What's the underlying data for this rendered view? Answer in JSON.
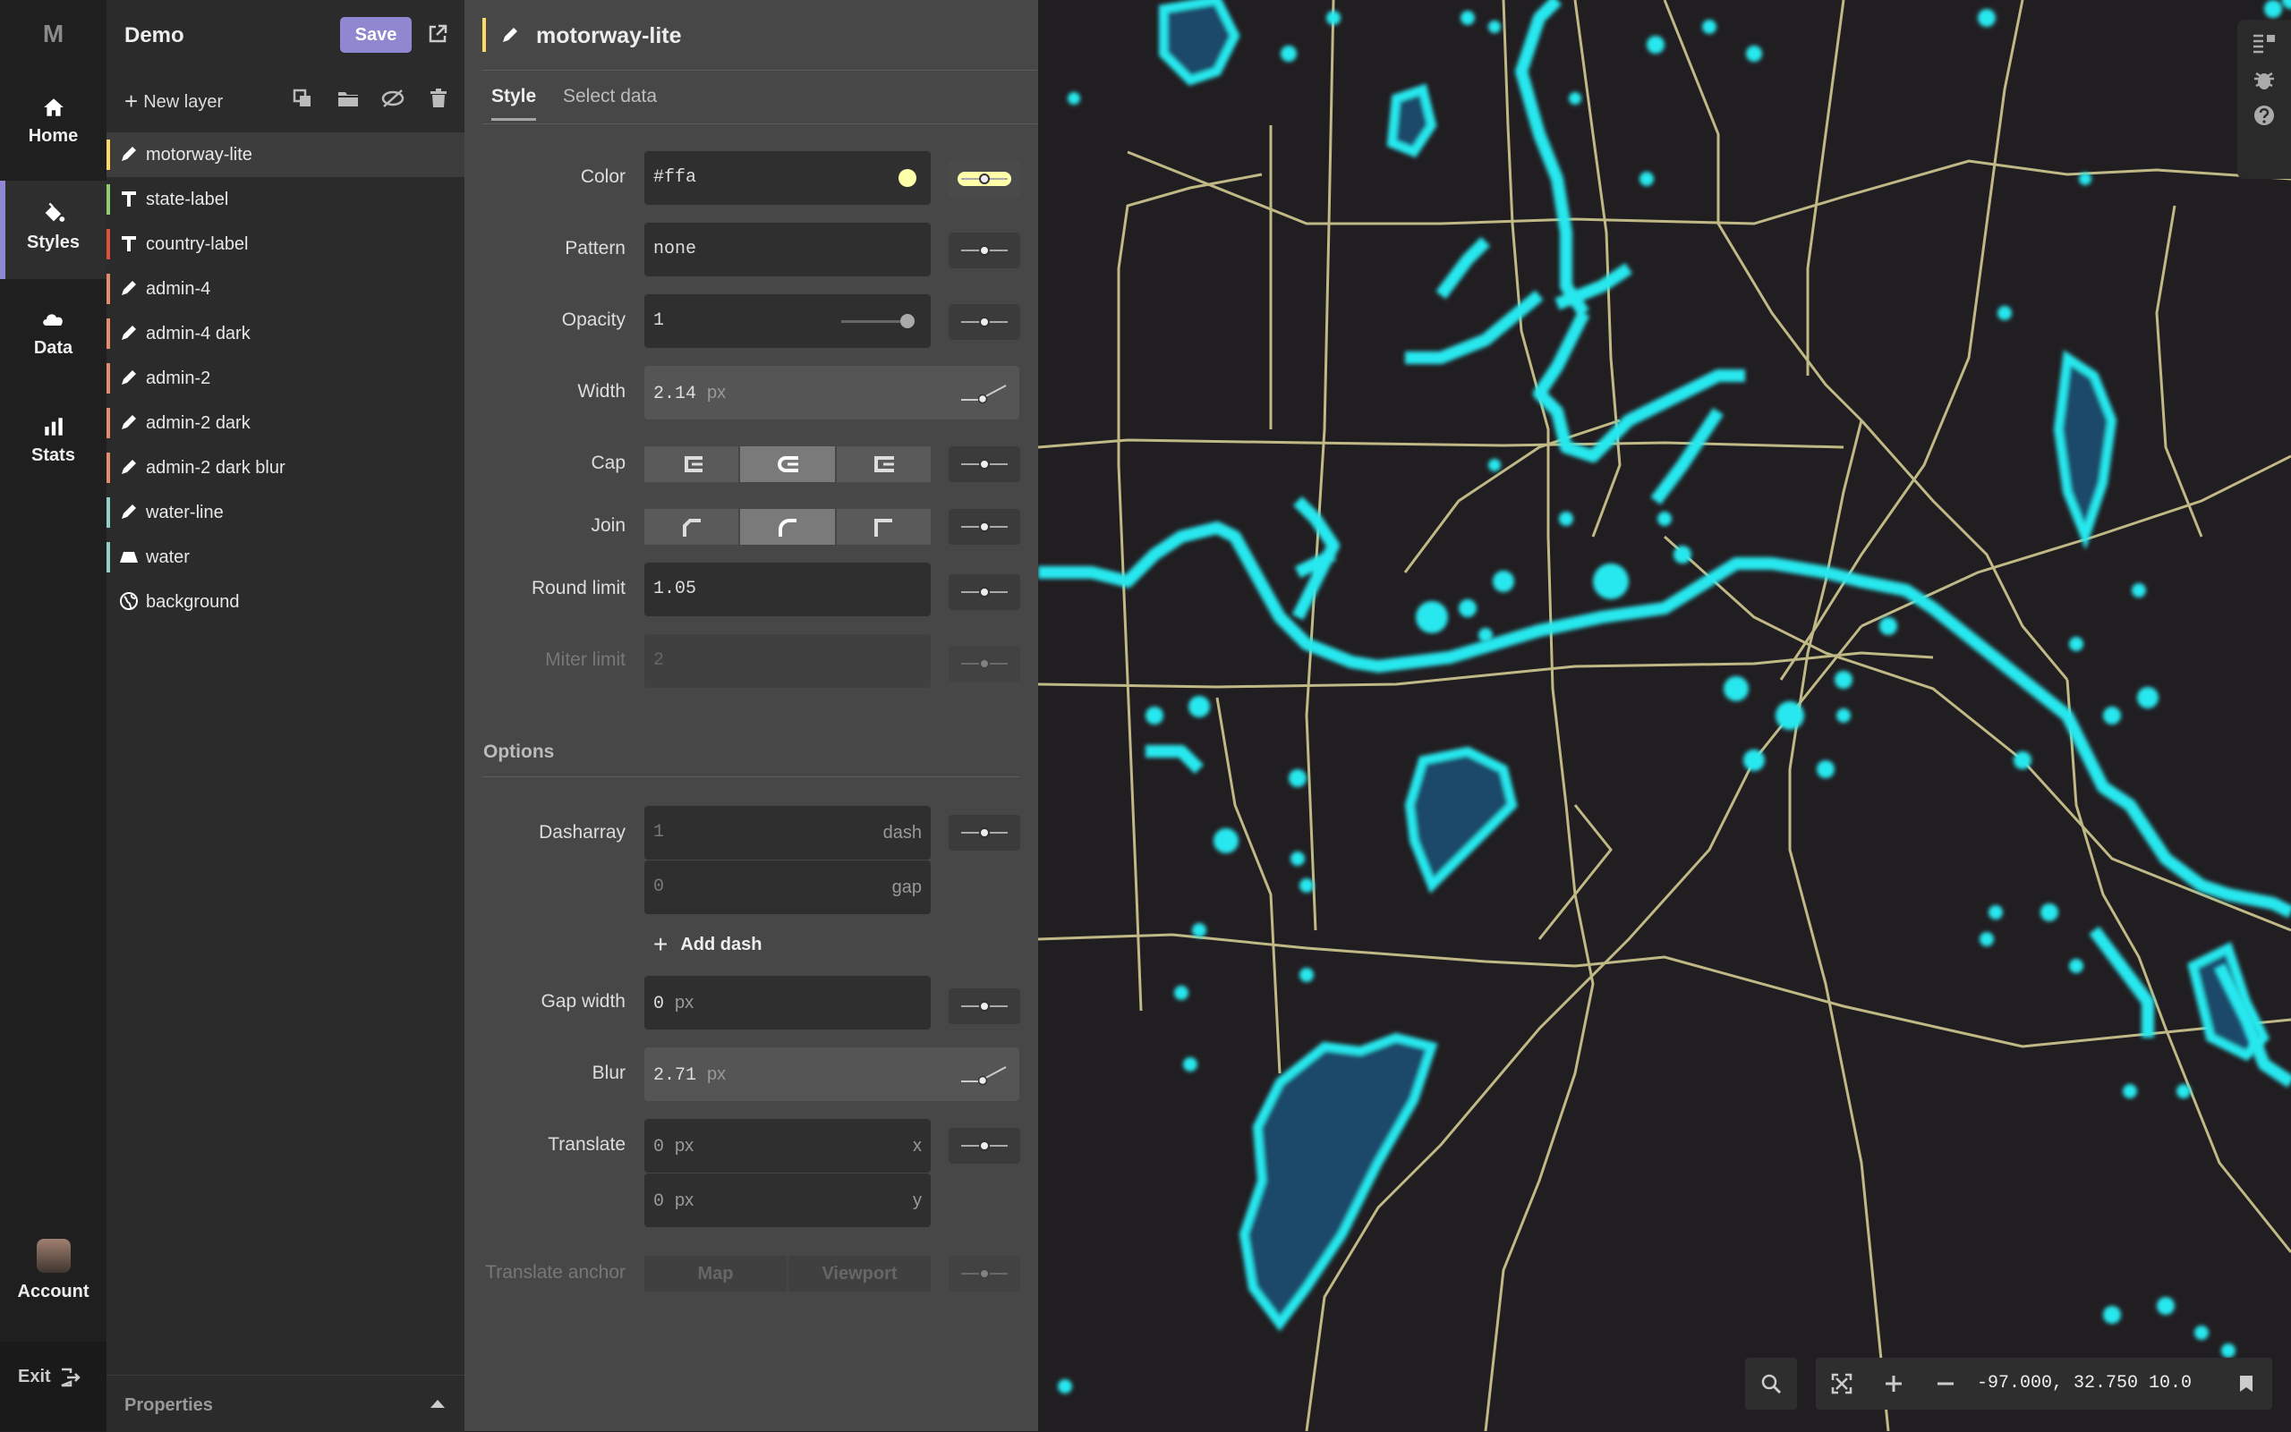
{
  "nav": {
    "logo": "M",
    "items": [
      {
        "label": "Home",
        "icon": "home-icon"
      },
      {
        "label": "Styles",
        "icon": "paint-bucket-icon"
      },
      {
        "label": "Data",
        "icon": "cloud-icon"
      },
      {
        "label": "Stats",
        "icon": "bar-chart-icon"
      }
    ],
    "account": "Account",
    "exit": "Exit"
  },
  "project": {
    "title": "Demo",
    "save": "Save",
    "new_layer": "New layer",
    "properties": "Properties"
  },
  "layers": [
    {
      "name": "motorway-lite",
      "color": "#ffd966",
      "type": "line"
    },
    {
      "name": "state-label",
      "color": "#8bd16b",
      "type": "symbol"
    },
    {
      "name": "country-label",
      "color": "#e0503a",
      "type": "symbol"
    },
    {
      "name": "admin-4",
      "color": "#e58a6a",
      "type": "line"
    },
    {
      "name": "admin-4 dark",
      "color": "#e58a6a",
      "type": "line"
    },
    {
      "name": "admin-2",
      "color": "#e58a6a",
      "type": "line"
    },
    {
      "name": "admin-2 dark",
      "color": "#e58a6a",
      "type": "line"
    },
    {
      "name": "admin-2 dark blur",
      "color": "#e58a6a",
      "type": "line"
    },
    {
      "name": "water-line",
      "color": "#8fd1c8",
      "type": "line"
    },
    {
      "name": "water",
      "color": "#8fd1c8",
      "type": "fill"
    },
    {
      "name": "background",
      "color": "#2b2b2b",
      "type": "background"
    }
  ],
  "editor": {
    "title": "motorway-lite",
    "tabs": [
      "Style",
      "Select data"
    ],
    "props": {
      "color": {
        "label": "Color",
        "value": "#ffa"
      },
      "pattern": {
        "label": "Pattern",
        "value": "none"
      },
      "opacity": {
        "label": "Opacity",
        "value": "1"
      },
      "width": {
        "label": "Width",
        "value": "2.14",
        "unit": "px"
      },
      "cap": {
        "label": "Cap"
      },
      "join": {
        "label": "Join"
      },
      "round_limit": {
        "label": "Round limit",
        "value": "1.05"
      },
      "miter_limit": {
        "label": "Miter limit",
        "value": "2"
      }
    },
    "options_title": "Options",
    "options": {
      "dasharray": {
        "label": "Dasharray",
        "dash_value": "1",
        "dash_suffix": "dash",
        "gap_value": "0",
        "gap_suffix": "gap",
        "add": "Add dash"
      },
      "gap_width": {
        "label": "Gap width",
        "value": "0",
        "unit": "px"
      },
      "blur": {
        "label": "Blur",
        "value": "2.71",
        "unit": "px"
      },
      "translate": {
        "label": "Translate",
        "x_value": "0",
        "x_unit": "px",
        "x_suffix": "x",
        "y_value": "0",
        "y_unit": "px",
        "y_suffix": "y"
      },
      "translate_anchor": {
        "label": "Translate anchor",
        "options": [
          "Map",
          "Viewport"
        ]
      }
    }
  },
  "map": {
    "coords": "-97.000, 32.750 10.0",
    "road_color": "#e8e0a0",
    "water_color": "#25e8ee"
  }
}
